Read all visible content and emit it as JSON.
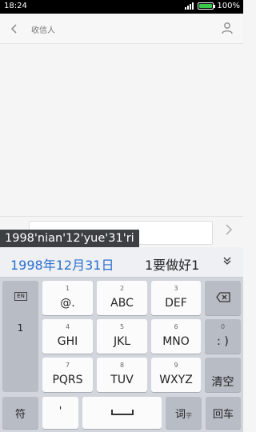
{
  "status_bar": {
    "time": "18:24",
    "battery": "100%"
  },
  "header": {
    "recipient_label": "收信人"
  },
  "composition": {
    "pinyin": "1998'nian'12'yue'31'ri"
  },
  "candidates": {
    "first": "1998年12月31日",
    "second": "1要做好1"
  },
  "keyboard": {
    "left_panel": {
      "en": "EN",
      "item": "1"
    },
    "keys": {
      "k1": {
        "num": "1",
        "label": "@."
      },
      "k2": {
        "num": "2",
        "label": "ABC"
      },
      "k3": {
        "num": "3",
        "label": "DEF"
      },
      "k4": {
        "num": "4",
        "label": "GHI"
      },
      "k5": {
        "num": "5",
        "label": "JKL"
      },
      "k6": {
        "num": "6",
        "label": "MNO"
      },
      "k7": {
        "num": "7",
        "label": "PQRS"
      },
      "k8": {
        "num": "8",
        "label": "TUV"
      },
      "k9": {
        "num": "9",
        "label": "WXYZ"
      },
      "k0": {
        "num": "0",
        "label": ": )"
      },
      "clear": "清空",
      "symbols": "符",
      "apostrophe": "'",
      "ci": "词",
      "ci_sub": "字",
      "enter": "回车"
    }
  }
}
